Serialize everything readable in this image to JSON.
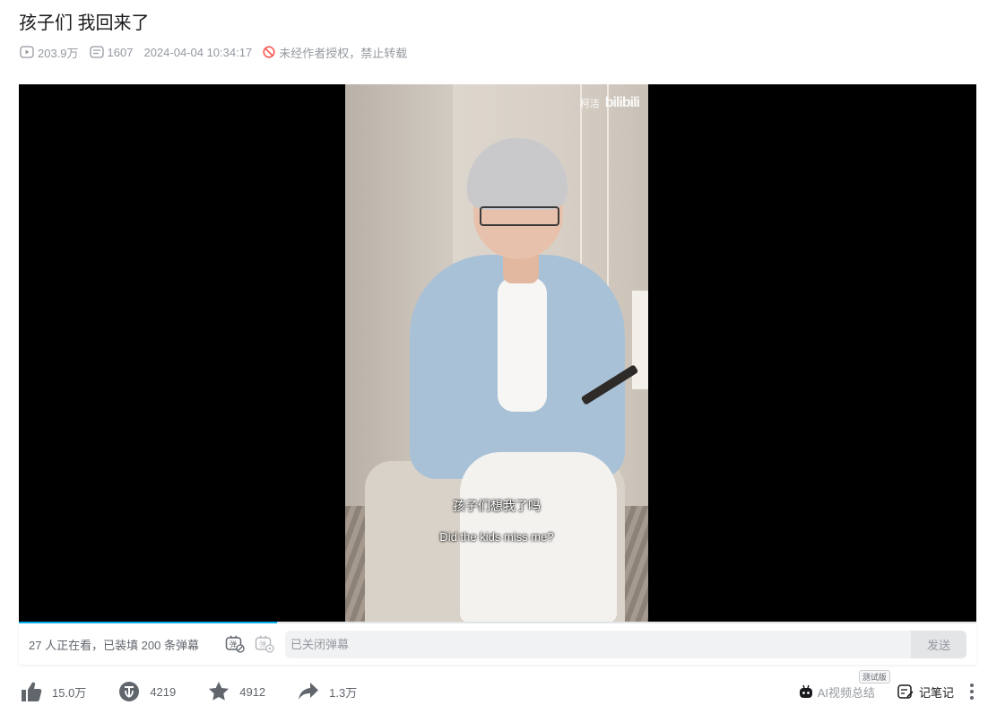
{
  "video": {
    "title": "孩子们 我回来了",
    "views": "203.9万",
    "danmaku_count": "1607",
    "publish_time": "2024-04-04 10:34:17",
    "copyright_notice": "未经作者授权，禁止转载"
  },
  "player": {
    "watermark_author": "柯洁",
    "watermark_logo": "bilibili",
    "subtitle_zh": "孩子们想我了吗",
    "subtitle_en": "Did the kids miss me?",
    "progress": 0.27
  },
  "danmaku_bar": {
    "status_text": "27 人正在看，已装填 200 条弹幕",
    "input_placeholder": "已关闭弹幕",
    "send_label": "发送"
  },
  "toolbar": {
    "like_count": "15.0万",
    "coin_count": "4219",
    "favorite_count": "4912",
    "share_count": "1.3万",
    "ai_summary_label": "AI视频总结",
    "ai_beta_badge": "测试版",
    "notes_label": "记笔记"
  },
  "colors": {
    "accent": "#00aeec",
    "muted_text": "#9499a0",
    "icon_gray": "#61666d"
  }
}
